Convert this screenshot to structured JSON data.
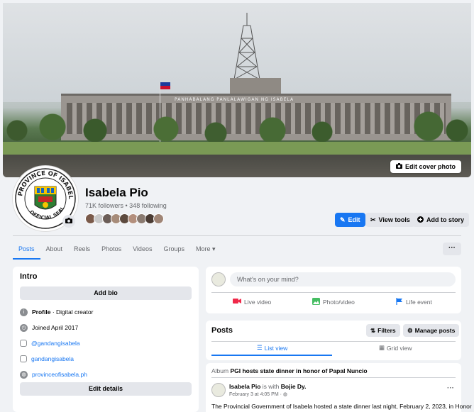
{
  "cover": {
    "edit_label": "Edit cover photo",
    "sign_text": "PANHABALANG PANLALAWIGAN NG ISABELA"
  },
  "profile": {
    "name": "Isabela Pio",
    "stats": "71K followers • 348 following",
    "seal_top": "PROVINCE OF ISABELA",
    "seal_bottom": "OFFICIAL SEAL",
    "friend_colors": [
      "#7a5a4a",
      "#c9c9c9",
      "#6b5d57",
      "#a78c7a",
      "#5c4a3e",
      "#b38f7d",
      "#8a7a70",
      "#4a3b33",
      "#9f8576"
    ]
  },
  "actions": {
    "edit": "Edit",
    "view_tools": "View tools",
    "add_story": "Add to story"
  },
  "tabs": [
    "Posts",
    "About",
    "Reels",
    "Photos",
    "Videos",
    "Groups",
    "More ▾"
  ],
  "more_menu": "···",
  "intro": {
    "title": "Intro",
    "add_bio": "Add bio",
    "profile_label": "Profile",
    "profile_value": " · Digital creator",
    "joined": "Joined April 2017",
    "instagram": "@gandangisabela",
    "instagram2": "gandangisabela",
    "website": "provinceofisabela.ph",
    "edit_details": "Edit details"
  },
  "composer": {
    "placeholder": "What's on your mind?",
    "live": "Live video",
    "photo": "Photo/video",
    "life": "Life event"
  },
  "posts_section": {
    "title": "Posts",
    "filters": "Filters",
    "manage": "Manage posts",
    "list_view": "List view",
    "grid_view": "Grid view"
  },
  "post": {
    "album_prefix": "Album",
    "album_title": "PGI hosts state dinner in honor of Papal Nuncio",
    "author": "Isabela Pio",
    "with_text": " is with ",
    "tagged": "Bojie Dy.",
    "time": "February 3 at 4:05 PM · ",
    "body": "The Provincial Government of Isabela hosted a state dinner last night, February 2, 2023, in Honor"
  },
  "colors": {
    "accent": "#1877f2",
    "live_red": "#f02849",
    "photo_green": "#45bd62",
    "life_blue": "#1877f2"
  }
}
